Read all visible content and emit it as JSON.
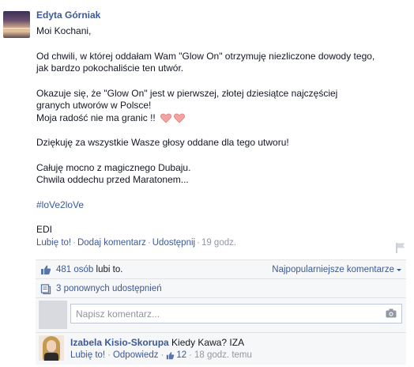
{
  "post": {
    "author": "Edyta Górniak",
    "paragraphs": [
      [
        "Moi Kochani,"
      ],
      [
        "Od chwili, w której oddałam Wam \"Glow On\" otrzymuję niezliczone dowody tego,",
        "jak bardzo pokochaliście ten utwór."
      ],
      [
        "Okazuje się, że \"Glow On\" jest w pierwszej, złotej dziesiątce najczęściej",
        "granych utworów w Polsce!",
        "Moja radość nie ma granic !!"
      ],
      [
        "Dziękuję za wszystkie Wasze głosy oddane dla tego utworu!"
      ],
      [
        "Całuję mocno z magicznego Dubaju.",
        "Chwila oddechu przed Maratonem..."
      ],
      [
        "#loVe2loVe"
      ],
      [
        "EDI"
      ]
    ],
    "actions": {
      "like": "Lubię to!",
      "comment": "Dodaj komentarz",
      "share": "Udostępnij",
      "time": "19 godz."
    }
  },
  "feedback": {
    "likes_count": "481 osób",
    "likes_suffix": " lubi to.",
    "top_comments": "Najpopularniejsze komentarze",
    "shares": "3 ponownych udostępnień",
    "compose_placeholder": "Napisz komentarz..."
  },
  "comment": {
    "author": "Izabela Kisio-Skorupa",
    "text": "Kiedy Kawa? IZA",
    "like": "Lubię to!",
    "reply": "Odpowiedz",
    "likes": "12",
    "time": "18 godz. temu"
  },
  "colors": {
    "link": "#3b5998",
    "meta": "#9197a3",
    "feedback_bg": "#f6f7f8",
    "heart": "#f4a3a3"
  }
}
